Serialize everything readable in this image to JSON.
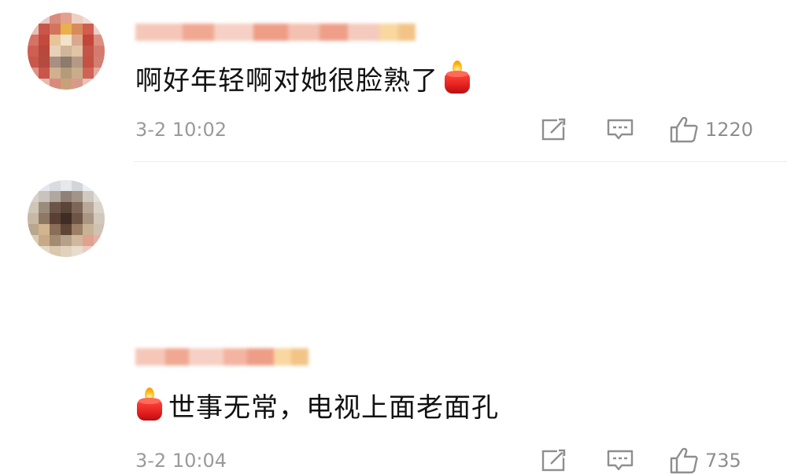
{
  "comments": [
    {
      "content": "啊好年轻啊对她很脸熟了",
      "emoji": "candle-icon",
      "emoji_position": "end",
      "timestamp": "3-2 10:02",
      "like_count": "1220"
    },
    {
      "content": "世事无常，电视上面老面孔",
      "emoji": "candle-icon",
      "emoji_position": "start",
      "timestamp": "3-2 10:04",
      "like_count": "735"
    }
  ],
  "colors": {
    "text": "#111111",
    "meta": "#9a9a9a",
    "candle": "#e51f1f",
    "flame": "#ffb300"
  }
}
